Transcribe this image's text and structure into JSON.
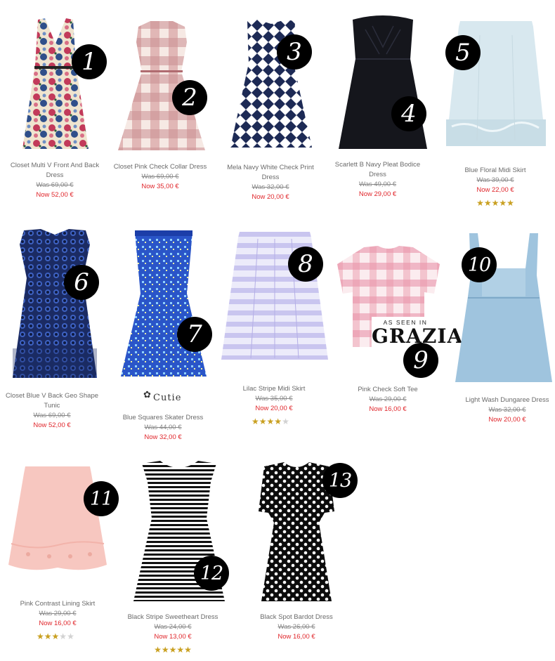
{
  "products": [
    {
      "num": "1",
      "name": "Closet Multi V Front And Back Dress",
      "was": "Was 69,00 €",
      "now": "Now 52,00 €"
    },
    {
      "num": "2",
      "name": "Closet Pink Check Collar Dress",
      "was": "Was 69,00 €",
      "now": "Now 35,00 €"
    },
    {
      "num": "3",
      "name": "Mela Navy White Check Print Dress",
      "was": "Was 32,00 €",
      "now": "Now 20,00 €"
    },
    {
      "num": "4",
      "name": "Scarlett B Navy Pleat Bodice Dress",
      "was": "Was 49,00 €",
      "now": "Now 29,00 €"
    },
    {
      "num": "5",
      "name": "Blue Floral Midi Skirt",
      "was": "Was 39,00 €",
      "now": "Now 22,00 €",
      "rating": 5
    },
    {
      "num": "6",
      "name": "Closet Blue V Back Geo Shape Tunic",
      "was": "Was 69,00 €",
      "now": "Now 52,00 €"
    },
    {
      "num": "7",
      "name": "Blue Squares Skater Dress",
      "was": "Was 44,00 €",
      "now": "Now 32,00 €"
    },
    {
      "num": "8",
      "name": "Lilac Stripe Midi Skirt",
      "was": "Was 35,00 €",
      "now": "Now 20,00 €",
      "rating": 3.5
    },
    {
      "num": "9",
      "name": "Pink Check Soft Tee",
      "was": "Was 29,00 €",
      "now": "Now 16,00 €"
    },
    {
      "num": "10",
      "name": "Light Wash Dungaree Dress",
      "was": "Was 32,00 €",
      "now": "Now 20,00 €"
    },
    {
      "num": "11",
      "name": "Pink Contrast Lining Skirt",
      "was": "Was 29,00 €",
      "now": "Now 16,00 €",
      "rating": 3
    },
    {
      "num": "12",
      "name": "Black Stripe Sweetheart Dress",
      "was": "Was 24,00 €",
      "now": "Now 13,00 €",
      "rating": 5
    },
    {
      "num": "13",
      "name": "Black Spot Bardot Dress",
      "was": "Was 26,00 €",
      "now": "Now 16,00 €"
    }
  ],
  "grazia": {
    "line1": "AS SEEN IN",
    "line2": "GRAZIA"
  },
  "cutie": {
    "text": "Cutie"
  },
  "colors": {
    "price_now": "#e0262b",
    "star_on": "#c9a021",
    "star_off": "#d2d2d2",
    "badge": "#000000"
  }
}
